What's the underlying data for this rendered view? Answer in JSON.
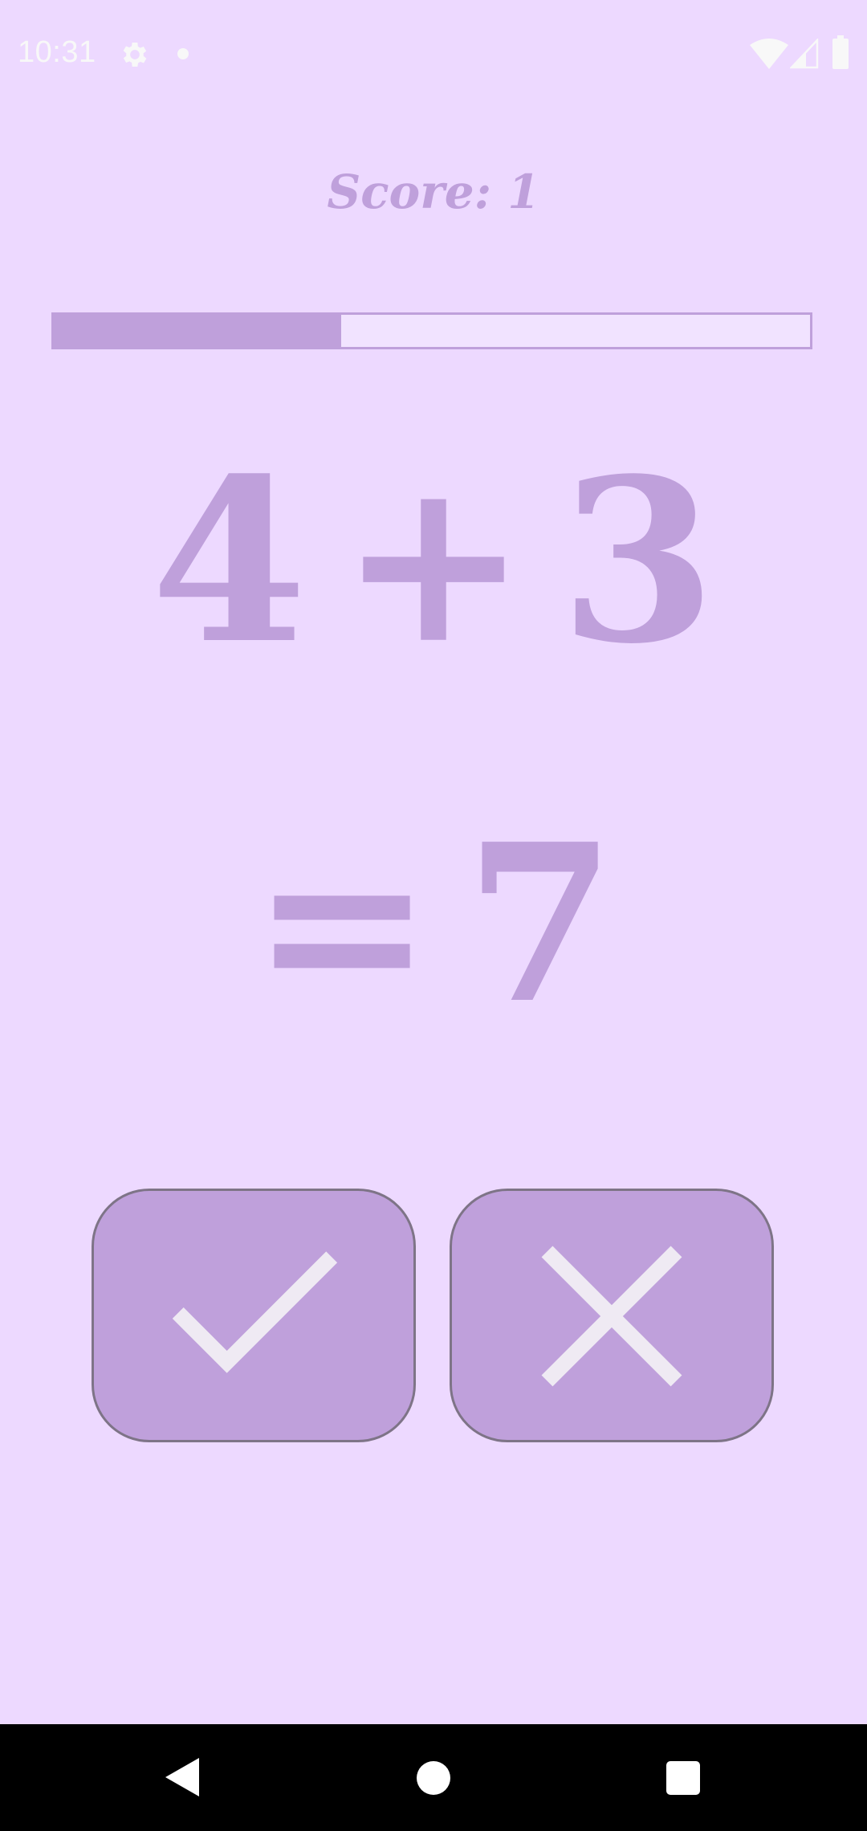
{
  "status_bar": {
    "time": "10:31",
    "icons": [
      "gear-icon",
      "notification-dot-icon",
      "wifi-icon",
      "cellular-signal-icon",
      "battery-icon"
    ],
    "icon_color": "#F8F8F8"
  },
  "game": {
    "score_text": "Score: 1",
    "progress_fraction": 0.38,
    "operand_a": "4",
    "operator": "+",
    "operand_b": "3",
    "equals": "=",
    "proposed_answer": "7"
  },
  "buttons": {
    "correct_icon": "checkmark-icon",
    "wrong_icon": "cross-icon"
  },
  "nav_bar": {
    "icons": [
      "back-icon",
      "home-icon",
      "recents-icon"
    ]
  },
  "colors": {
    "background": "#EDD9FF",
    "accent": "#BFA0DB",
    "button_border": "#7E7487",
    "button_icon": "#EFEAF3",
    "nav_background": "#000000"
  }
}
